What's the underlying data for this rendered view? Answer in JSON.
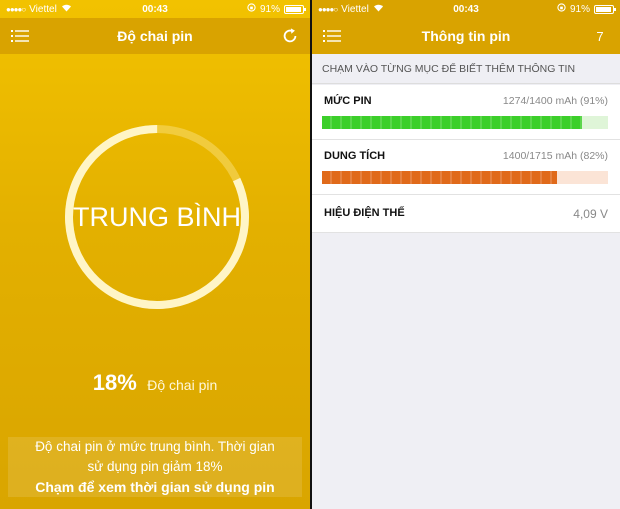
{
  "status": {
    "carrier": "Viettel",
    "time": "00:43",
    "battery_text": "91%",
    "battery_level": 0.91
  },
  "left": {
    "nav_title": "Độ chai pin",
    "ring_label": "TRUNG BÌNH",
    "wear_percent": "18%",
    "wear_label": "Độ chai pin",
    "wear_level": 0.18,
    "message_line1": "Độ chai pin ở mức trung bình. Thời gian",
    "message_line2": "sử dụng pin giảm 18%",
    "cta": "Chạm để xem thời gian sử dụng pin",
    "colors": {
      "accent": "#f0c000",
      "ring": "#fff3b0"
    }
  },
  "right": {
    "nav_title": "Thông tin pin",
    "nav_right": "7",
    "section_header": "CHẠM VÀO TỪNG MỤC ĐỂ BIẾT THÊM THÔNG TIN",
    "rows": [
      {
        "label": "MỨC PIN",
        "value": "1274/1400 mAh (91%)",
        "level": 0.91,
        "color": "#3ccf2a",
        "track": "#dff5d8"
      },
      {
        "label": "DUNG TÍCH",
        "value": "1400/1715 mAh (82%)",
        "level": 0.82,
        "color": "#e06a1a",
        "track": "#fbe4d6"
      },
      {
        "label": "HIỆU ĐIỆN THẾ",
        "value": "4,09 V"
      }
    ]
  },
  "icons": {
    "menu": "menu-icon",
    "refresh": "refresh-icon",
    "wifi": "wifi-icon",
    "lock": "rotation-lock-icon",
    "battery": "battery-icon"
  }
}
